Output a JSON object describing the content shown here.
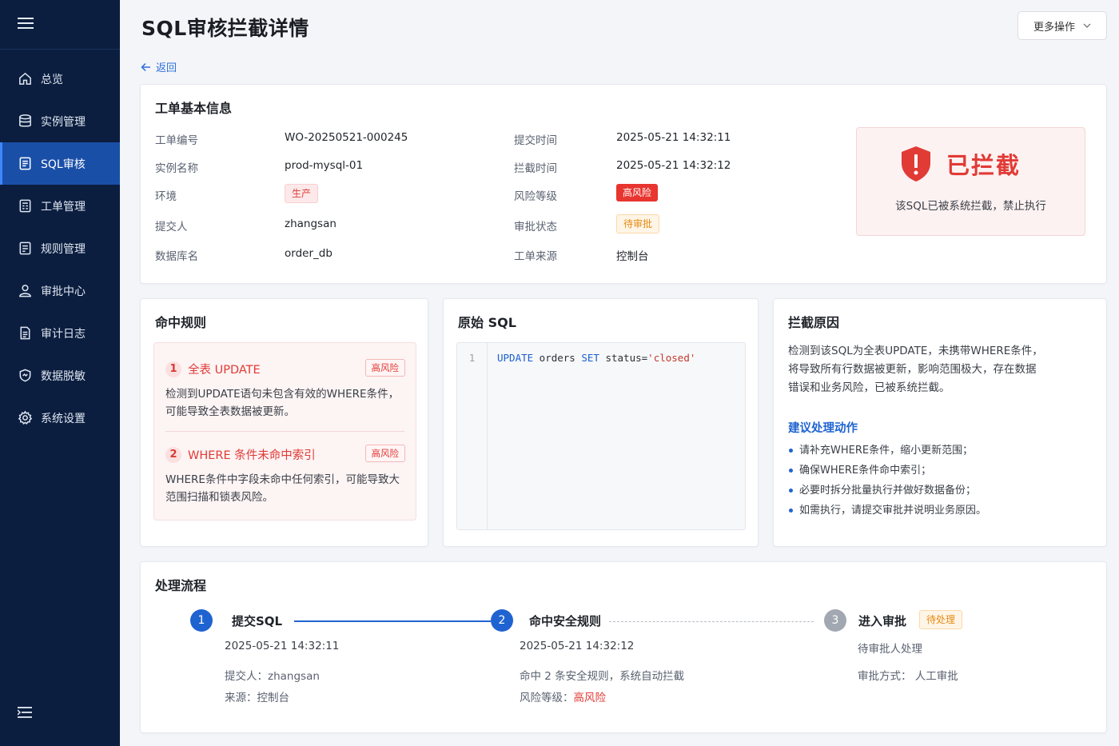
{
  "sidebar": {
    "items": [
      {
        "label": "总览",
        "icon": "home-icon"
      },
      {
        "label": "实例管理",
        "icon": "database-icon"
      },
      {
        "label": "SQL审核",
        "icon": "audit-doc-icon",
        "active": true
      },
      {
        "label": "工单管理",
        "icon": "ticket-icon"
      },
      {
        "label": "规则管理",
        "icon": "rules-icon"
      },
      {
        "label": "审批中心",
        "icon": "user-icon"
      },
      {
        "label": "审计日志",
        "icon": "log-icon"
      },
      {
        "label": "数据脱敏",
        "icon": "shield-mask-icon"
      },
      {
        "label": "系统设置",
        "icon": "gear-icon"
      }
    ]
  },
  "header": {
    "title": "SQL审核拦截详情",
    "more_label": "更多操作",
    "back_label": "返回"
  },
  "info": {
    "title": "工单基本信息",
    "order_no_label": "工单编号",
    "order_no": "WO-20250521-000245",
    "instance_label": "实例名称",
    "instance": "prod-mysql-01",
    "env_label": "环境",
    "env": "生产",
    "submitter_label": "提交人",
    "submitter": "zhangsan",
    "db_label": "数据库名",
    "db": "order_db",
    "submit_time_label": "提交时间",
    "submit_time": "2025-05-21 14:32:11",
    "block_time_label": "拦截时间",
    "block_time": "2025-05-21 14:32:12",
    "risk_label": "风险等级",
    "risk": "高风险",
    "approval_label": "审批状态",
    "approval": "待审批",
    "source_label": "工单来源",
    "source": "控制台",
    "block_status": "已拦截",
    "block_desc": "该SQL已被系统拦截，禁止执行"
  },
  "rules": {
    "title": "命中规则",
    "items": [
      {
        "num": "1",
        "title": "全表 UPDATE",
        "tag": "高风险",
        "desc1": "检测到UPDATE语句未包含有效的WHERE条件，",
        "desc2": "可能导致全表数据被更新。"
      },
      {
        "num": "2",
        "title": "WHERE 条件未命中索引",
        "tag": "高风险",
        "desc1": "WHERE条件中字段未命中任何索引，可能导致大",
        "desc2": "范围扫描和锁表风险。"
      }
    ]
  },
  "sql": {
    "title": "原始 SQL",
    "line_no": "1",
    "kw1": "UPDATE",
    "part1": " orders ",
    "kw2": "SET",
    "part2": " status=",
    "str": "'closed'"
  },
  "reason": {
    "title": "拦截原因",
    "line1": "检测到该SQL为全表UPDATE，未携带WHERE条件，",
    "line2": "将导致所有行数据被更新，影响范围极大，存在数据",
    "line3": "错误和业务风险，已被系统拦截。",
    "suggest_title": "建议处理动作",
    "suggestions": [
      "请补充WHERE条件，缩小更新范围；",
      "确保WHERE条件命中索引；",
      "必要时拆分批量执行并做好数据备份；",
      "如需执行，请提交审批并说明业务原因。"
    ]
  },
  "process": {
    "title": "处理流程",
    "steps": [
      {
        "num": "1",
        "name": "提交SQL",
        "time": "2025-05-21 14:32:11",
        "line1": "提交人：zhangsan",
        "line2": "来源：控制台"
      },
      {
        "num": "2",
        "name": "命中安全规则",
        "time": "2025-05-21 14:32:12",
        "line1": "命中 2 条安全规则，系统自动拦截",
        "line2_label": "风险等级：",
        "line2_value": "高风险"
      },
      {
        "num": "3",
        "name": "进入审批",
        "tag": "待处理",
        "time": "待审批人处理",
        "line1": "审批方式：  人工审批"
      }
    ]
  },
  "colors": {
    "sidebar_bg": "#0b1e3f",
    "active": "#1a4fa8",
    "primary": "#1f63d1",
    "danger": "#e13b36",
    "warning": "#e58a13"
  }
}
